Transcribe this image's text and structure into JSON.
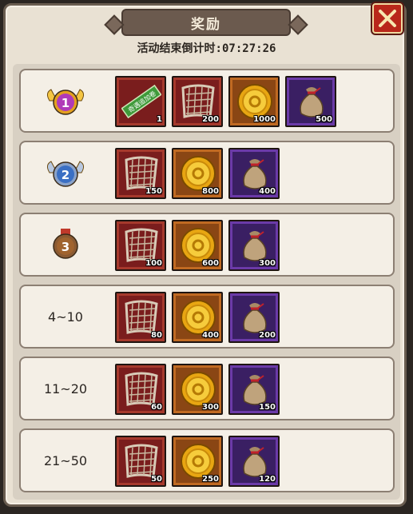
{
  "header": {
    "title": "奖励",
    "countdown_label": "活动结束倒计时:",
    "countdown_time": "07:27:26"
  },
  "colors": {
    "slot_red": "#7a1d1d",
    "slot_orange": "#8a4614",
    "slot_purple": "#3a1f63",
    "close_button": "#b9271a"
  },
  "rows": [
    {
      "rank_label": "",
      "rank_icon": "gold-medal-1-icon",
      "medal_number": "1",
      "items": [
        {
          "icon": "ticket-icon",
          "tier": "red",
          "qty": "1",
          "ticket_text": "奇遇追加卷"
        },
        {
          "icon": "net-icon",
          "tier": "red",
          "qty": "200"
        },
        {
          "icon": "gold-coin-icon",
          "tier": "orange",
          "qty": "1000"
        },
        {
          "icon": "money-bag-icon",
          "tier": "purple",
          "qty": "500"
        }
      ]
    },
    {
      "rank_label": "",
      "rank_icon": "silver-medal-2-icon",
      "medal_number": "2",
      "items": [
        {
          "icon": "net-icon",
          "tier": "red",
          "qty": "150"
        },
        {
          "icon": "gold-coin-icon",
          "tier": "orange",
          "qty": "800"
        },
        {
          "icon": "money-bag-icon",
          "tier": "purple",
          "qty": "400"
        }
      ]
    },
    {
      "rank_label": "",
      "rank_icon": "bronze-medal-3-icon",
      "medal_number": "3",
      "items": [
        {
          "icon": "net-icon",
          "tier": "red",
          "qty": "100"
        },
        {
          "icon": "gold-coin-icon",
          "tier": "orange",
          "qty": "600"
        },
        {
          "icon": "money-bag-icon",
          "tier": "purple",
          "qty": "300"
        }
      ]
    },
    {
      "rank_label": "4~10",
      "items": [
        {
          "icon": "net-icon",
          "tier": "red",
          "qty": "80"
        },
        {
          "icon": "gold-coin-icon",
          "tier": "orange",
          "qty": "400"
        },
        {
          "icon": "money-bag-icon",
          "tier": "purple",
          "qty": "200"
        }
      ]
    },
    {
      "rank_label": "11~20",
      "items": [
        {
          "icon": "net-icon",
          "tier": "red",
          "qty": "60"
        },
        {
          "icon": "gold-coin-icon",
          "tier": "orange",
          "qty": "300"
        },
        {
          "icon": "money-bag-icon",
          "tier": "purple",
          "qty": "150"
        }
      ]
    },
    {
      "rank_label": "21~50",
      "items": [
        {
          "icon": "net-icon",
          "tier": "red",
          "qty": "50"
        },
        {
          "icon": "gold-coin-icon",
          "tier": "orange",
          "qty": "250"
        },
        {
          "icon": "money-bag-icon",
          "tier": "purple",
          "qty": "120"
        }
      ]
    }
  ]
}
